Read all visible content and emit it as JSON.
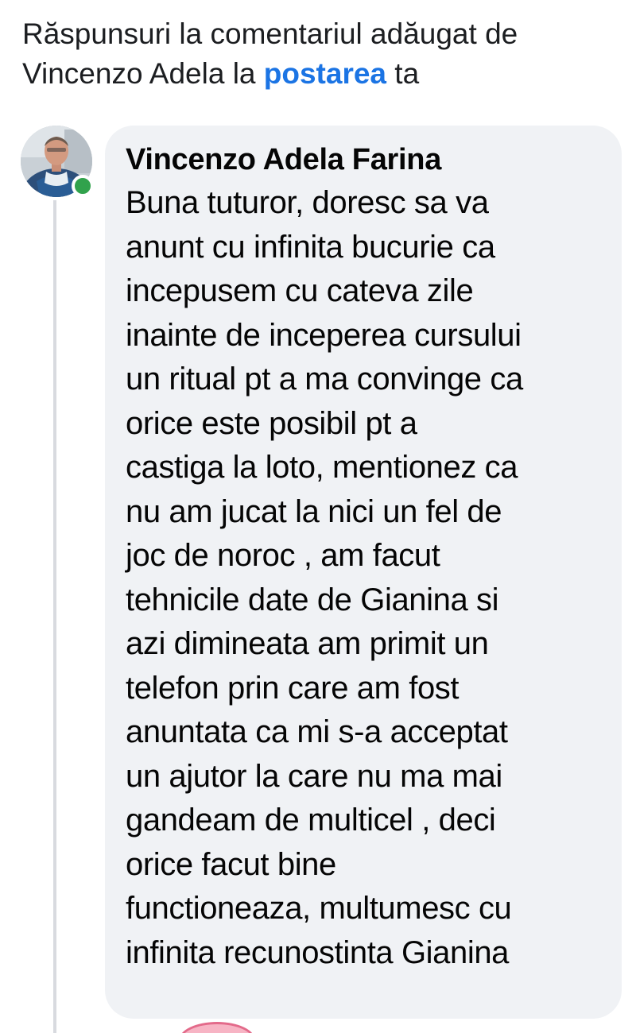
{
  "header": {
    "line1": "Răspunsuri la comentariul adăugat de",
    "line2_prefix": "Vincenzo Adela la ",
    "line2_link": "postarea",
    "line2_suffix": " ta"
  },
  "comment": {
    "author": "Vincenzo Adela Farina",
    "online_status": "online",
    "lines": [
      "Buna tuturor, doresc sa va",
      "anunt cu infinita bucurie ca",
      "incepusem cu cateva zile",
      "inainte de inceperea cursului",
      "un ritual pt a ma convinge ca",
      "orice este posibil pt a",
      "castiga la loto, mentionez ca",
      "nu am jucat la nici un fel de",
      "joc de noroc , am facut",
      "tehnicile date de Gianina si",
      "azi dimineata am primit un",
      "telefon prin care am fost",
      "anuntata ca mi s-a acceptat",
      "un ajutor la care nu ma mai",
      "gandeam de multicel , deci",
      "orice facut bine",
      "functioneaza, multumesc cu",
      "infinita recunostinta Gianina"
    ]
  },
  "colors": {
    "link": "#1b74e4",
    "bubble_bg": "#f0f2f5",
    "online_dot": "#31a24c",
    "thread_line": "#d8dadf"
  },
  "icons": {
    "avatar": "user-avatar-photo",
    "online": "online-dot-icon"
  }
}
